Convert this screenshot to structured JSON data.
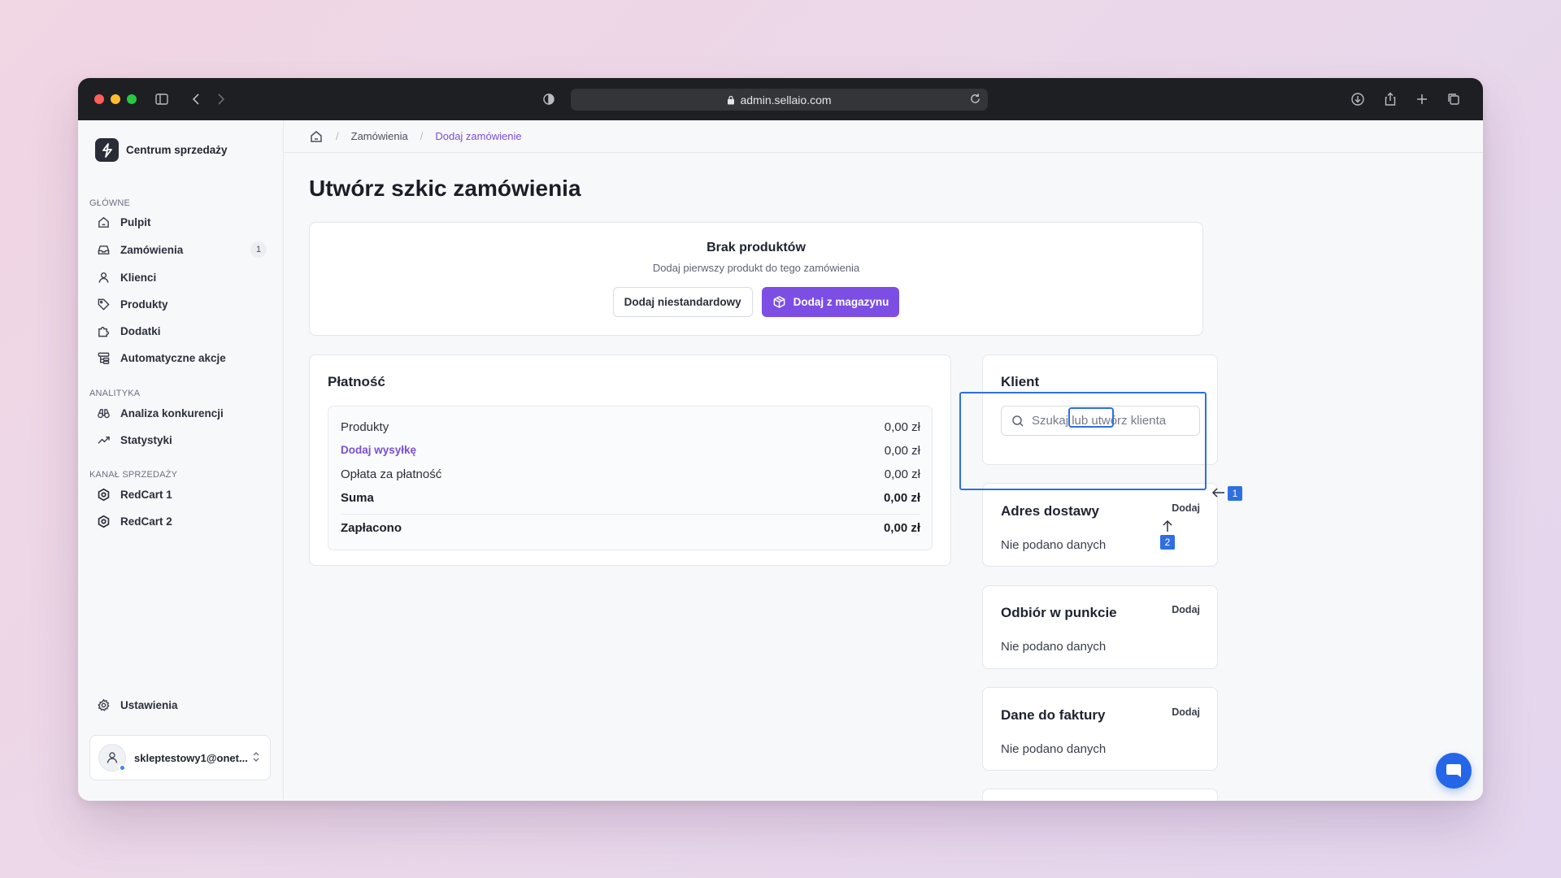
{
  "browser": {
    "url": "admin.sellaio.com",
    "traffic_lights": [
      "#ff5f57",
      "#febc2e",
      "#28c840"
    ]
  },
  "sidebar": {
    "brand": "Centrum sprzedaży",
    "sections": {
      "main": "GŁÓWNE",
      "analytics": "ANALITYKA",
      "channel": "KANAŁ SPRZEDAŻY"
    },
    "items": [
      {
        "label": "Pulpit",
        "icon": "home-icon"
      },
      {
        "label": "Zamówienia",
        "icon": "inbox-icon",
        "badge": "1"
      },
      {
        "label": "Klienci",
        "icon": "user-icon"
      },
      {
        "label": "Produkty",
        "icon": "tag-icon"
      },
      {
        "label": "Dodatki",
        "icon": "puzzle-icon"
      },
      {
        "label": "Automatyczne akcje",
        "icon": "automation-icon"
      },
      {
        "label": "Analiza konkurencji",
        "icon": "binoculars-icon"
      },
      {
        "label": "Statystyki",
        "icon": "trending-icon"
      },
      {
        "label": "RedCart 1",
        "icon": "store-icon"
      },
      {
        "label": "RedCart 2",
        "icon": "store-icon"
      }
    ],
    "settings": "Ustawienia",
    "user_email": "skleptestowy1@onet..."
  },
  "breadcrumb": {
    "items": [
      "Zamówienia",
      "Dodaj zamówienie"
    ]
  },
  "page": {
    "title": "Utwórz szkic zamówienia"
  },
  "products": {
    "title": "Brak produktów",
    "subtitle": "Dodaj pierwszy produkt do tego zamówienia",
    "custom_button": "Dodaj niestandardowy",
    "warehouse_button": "Dodaj z magazynu"
  },
  "payment": {
    "title": "Płatność",
    "rows": [
      {
        "label": "Produkty",
        "value": "0,00 zł"
      },
      {
        "label": "Dodaj wysyłkę",
        "value": "0,00 zł"
      },
      {
        "label": "Opłata za płatność",
        "value": "0,00 zł"
      },
      {
        "label": "Suma",
        "value": "0,00 zł"
      },
      {
        "label": "Zapłacono",
        "value": "0,00 zł"
      }
    ]
  },
  "customer": {
    "title": "Klient",
    "search_placeholder": "Szukaj lub utwórz klienta"
  },
  "shipping": {
    "title": "Adres dostawy",
    "add": "Dodaj",
    "empty": "Nie podano danych"
  },
  "pickup": {
    "title": "Odbiór w punkcie",
    "add": "Dodaj",
    "empty": "Nie podano danych"
  },
  "invoice": {
    "title": "Dane do faktury",
    "add": "Dodaj",
    "empty": "Nie podano danych"
  },
  "annotations": {
    "badge1": "1",
    "badge2": "2",
    "color": "#2f6fe0"
  },
  "colors": {
    "accent": "#7c4ee4",
    "link": "#7a4fd6"
  }
}
